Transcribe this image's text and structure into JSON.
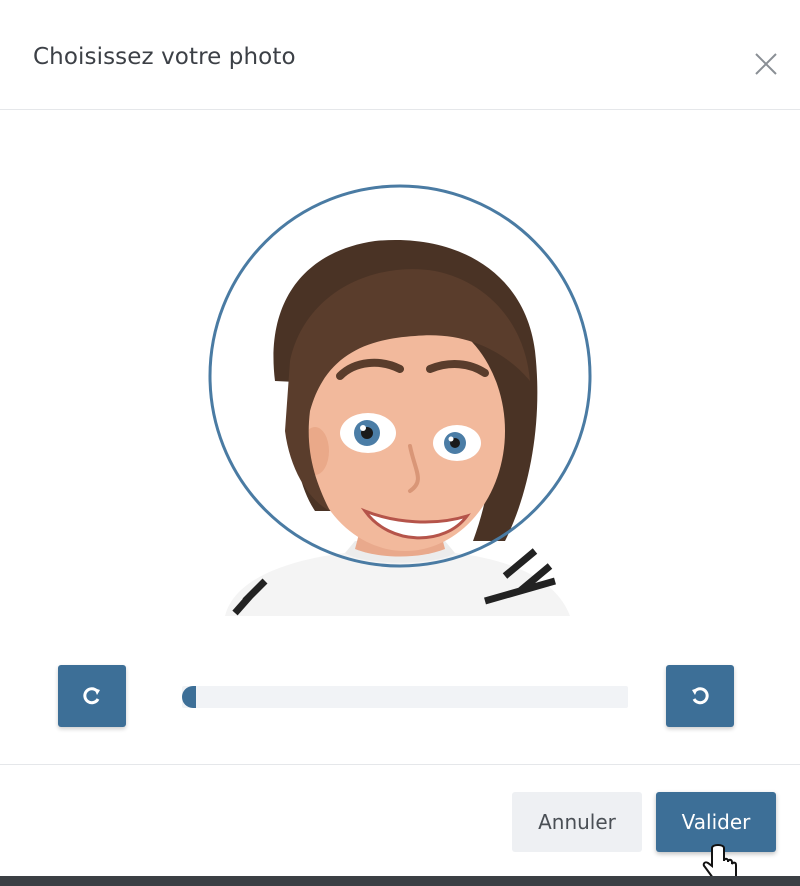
{
  "dialog": {
    "title": "Choisissez votre photo",
    "close_icon": "close-icon"
  },
  "editor": {
    "rotate_left_icon": "rotate-clockwise-icon",
    "rotate_right_icon": "rotate-counterclockwise-icon",
    "zoom_value": 0.0
  },
  "footer": {
    "cancel_label": "Annuler",
    "confirm_label": "Valider"
  },
  "colors": {
    "accent": "#3d6f97",
    "cancel_bg": "#eef0f3",
    "crop_circle": "#4a7ba3"
  }
}
